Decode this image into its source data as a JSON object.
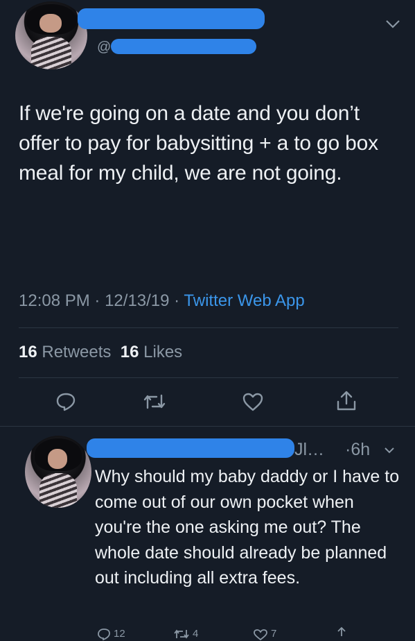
{
  "tweet": {
    "handle": "@",
    "text": "If we're going on a date and you don’t offer to pay for babysitting + a to go box meal for my child, we are not going.",
    "time": "12:08 PM",
    "date": "12/13/19",
    "source": "Twitter Web App",
    "retweets_count": "16",
    "retweets_label": "Retweets",
    "likes_count": "16",
    "likes_label": "Likes",
    "icons": [
      "reply-icon",
      "retweet-icon",
      "like-icon",
      "share-icon"
    ]
  },
  "reply": {
    "name_tail": "Jl…",
    "time": "·6h",
    "text": "Why should my baby daddy or I have to come out of our own pocket when you're the one asking me out? The whole date should already be planned out including all extra fees.",
    "reply_count": "12",
    "retweet_count": "4",
    "like_count": "7"
  },
  "colors": {
    "background": "#151c27",
    "link": "#3b96ea",
    "muted": "#8b98a5",
    "redaction": "#2f83e8"
  }
}
